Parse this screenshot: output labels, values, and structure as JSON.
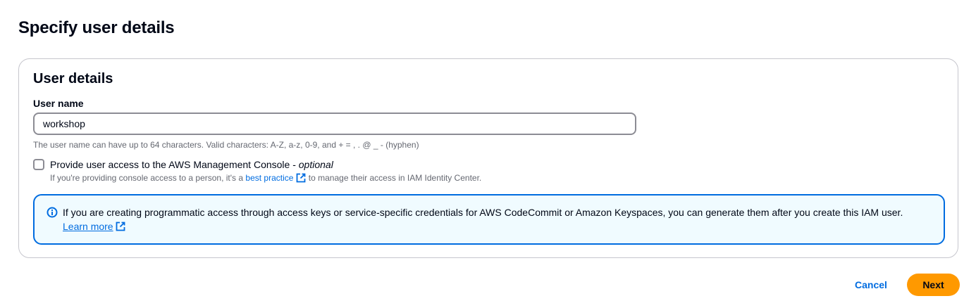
{
  "page": {
    "title": "Specify user details"
  },
  "user_details": {
    "header": "User details",
    "user_name": {
      "label": "User name",
      "value": "workshop",
      "constraint": "The user name can have up to 64 characters. Valid characters: A-Z, a-z, 0-9, and + = , . @ _ - (hyphen)"
    },
    "console_access": {
      "checked": false,
      "label": "Provide user access to the AWS Management Console - ",
      "optional": "optional",
      "desc_before": "If you're providing console access to a person, it's a ",
      "desc_link": "best practice",
      "desc_after": " to manage their access in IAM Identity Center."
    },
    "info_alert": {
      "text": "If you are creating programmatic access through access keys or service-specific credentials for AWS CodeCommit or Amazon Keyspaces, you can generate them after you create this IAM user.",
      "link": "Learn more"
    }
  },
  "actions": {
    "cancel": "Cancel",
    "next": "Next"
  },
  "colors": {
    "primary_button": "#ff9900",
    "link": "#006ce0",
    "alert_border": "#006ce0",
    "alert_bg": "#f0fbff"
  },
  "icons": {
    "external_link": "external-link-icon",
    "info": "info-icon"
  }
}
